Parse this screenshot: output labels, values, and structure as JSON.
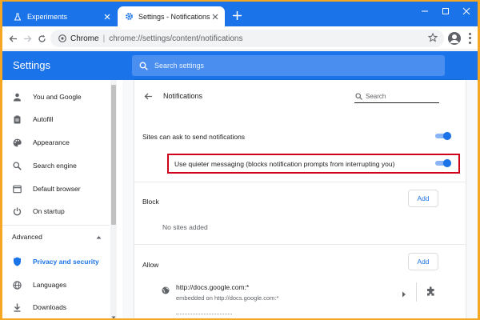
{
  "window": {
    "tabs": [
      {
        "label": "Experiments",
        "icon": "experiments-flask-icon",
        "active": false
      },
      {
        "label": "Settings - Notifications",
        "icon": "settings-gear-icon",
        "active": true
      }
    ],
    "new_tab_icon": "plus-icon",
    "controls": [
      "minimize-icon",
      "maximize-icon",
      "close-icon"
    ]
  },
  "address_bar": {
    "site_label": "Chrome",
    "separator": "|",
    "url": "chrome://settings/content/notifications"
  },
  "settings_header": {
    "title": "Settings",
    "search_placeholder": "Search settings"
  },
  "sidebar": {
    "items": [
      {
        "label": "You and Google",
        "icon": "person-icon"
      },
      {
        "label": "Autofill",
        "icon": "clipboard-icon"
      },
      {
        "label": "Appearance",
        "icon": "palette-icon"
      },
      {
        "label": "Search engine",
        "icon": "search-icon"
      },
      {
        "label": "Default browser",
        "icon": "browser-window-icon"
      },
      {
        "label": "On startup",
        "icon": "power-icon"
      }
    ],
    "advanced_label": "Advanced",
    "advanced_items": [
      {
        "label": "Privacy and security",
        "icon": "shield-icon",
        "selected": true
      },
      {
        "label": "Languages",
        "icon": "globe-icon"
      },
      {
        "label": "Downloads",
        "icon": "download-icon"
      }
    ]
  },
  "notifications_page": {
    "title": "Notifications",
    "search_placeholder": "Search",
    "ask_to_send_label": "Sites can ask to send notifications",
    "ask_to_send_enabled": true,
    "quieter_label": "Use quieter messaging (blocks notification prompts from interrupting you)",
    "quieter_enabled": true,
    "block": {
      "title": "Block",
      "add_label": "Add",
      "empty_text": "No sites added"
    },
    "allow": {
      "title": "Allow",
      "add_label": "Add",
      "sites": [
        {
          "url": "http://docs.google.com:*",
          "subtitle": "embedded on http://docs.google.com:*"
        }
      ]
    }
  },
  "colors": {
    "accent": "#1a73e8",
    "highlight_border": "#d0021b",
    "frame": "#f5a623"
  }
}
